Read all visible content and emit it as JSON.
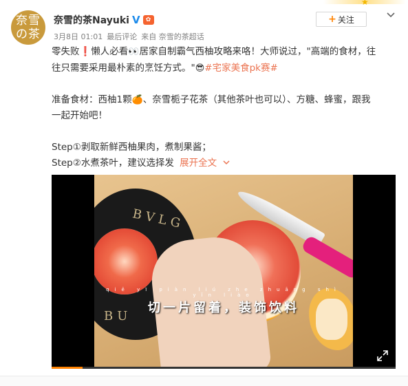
{
  "post": {
    "avatar_text": [
      "奈雪",
      "の茶"
    ],
    "username": "奈雪的茶Nayuki",
    "verified_mark": "V",
    "date": "3月8日 01:01",
    "edited_label": "最后评论",
    "source": "来自 奈雪的茶超话",
    "follow_label": "关注",
    "follow_icon": "plus-icon",
    "more_icon": "chevron-down-icon"
  },
  "content": {
    "line1_a": "零失败",
    "line1_excl": "❗",
    "line1_b": "懒人必看",
    "line1_eyes": "👀",
    "line1_c": "居家自制霸气西柚攻略来咯！大师说过，\"高端的食材，往",
    "line2_a": "往只需要采用最朴素的烹饪方式。\"",
    "line2_emoji": "😎",
    "line2_tag": "#宅家美食pk赛#",
    "line3_a": "准备食材：西柚1颗",
    "line3_emoji": "🍊",
    "line3_b": "、奈雪栀子花茶（其他茶叶也可以）、方糖、蜂蜜，跟我",
    "line4": "一起开始吧！",
    "step1": "Step①剥取新鲜西柚果肉，煮制果酱；",
    "step2": "Step②水煮茶叶，建议选择发",
    "expand_label": "展开全文",
    "expand_icon": "chevron-down-icon"
  },
  "video": {
    "plate_text_top": "BVLG",
    "plate_text_bottom": "BU",
    "pinyin": "qiē yī piàn liú zhe zhuāng shì yǐn liào",
    "subtitle": "切一片留着，装饰饮料",
    "fullscreen_icon": "fullscreen-icon",
    "progress": 0.09
  },
  "colors": {
    "link": "#eb7350",
    "accent": "#ff8200",
    "verified": "#1f8ceb"
  }
}
